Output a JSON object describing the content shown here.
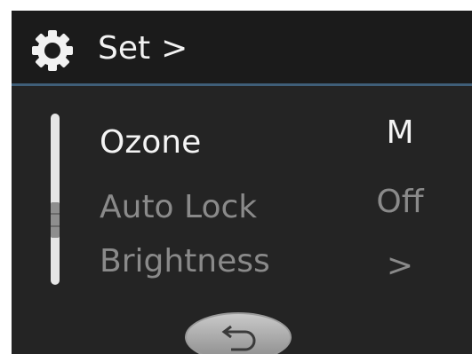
{
  "header": {
    "icon": "gear-icon",
    "title": "Set",
    "chevron": ">"
  },
  "menu": {
    "items": [
      {
        "label": "Ozone",
        "value": "M",
        "selected": true
      },
      {
        "label": "Auto Lock",
        "value": "Off",
        "selected": false
      },
      {
        "label": "Brightness",
        "value": ">",
        "selected": false
      }
    ]
  },
  "footer": {
    "back_icon": "return-arrow-icon"
  },
  "colors": {
    "background": "#242424",
    "header": "#1b1b1b",
    "accent_line": "#3f5e78",
    "selected_text": "#f4f4f4",
    "dim_text": "#8a8a8a"
  }
}
